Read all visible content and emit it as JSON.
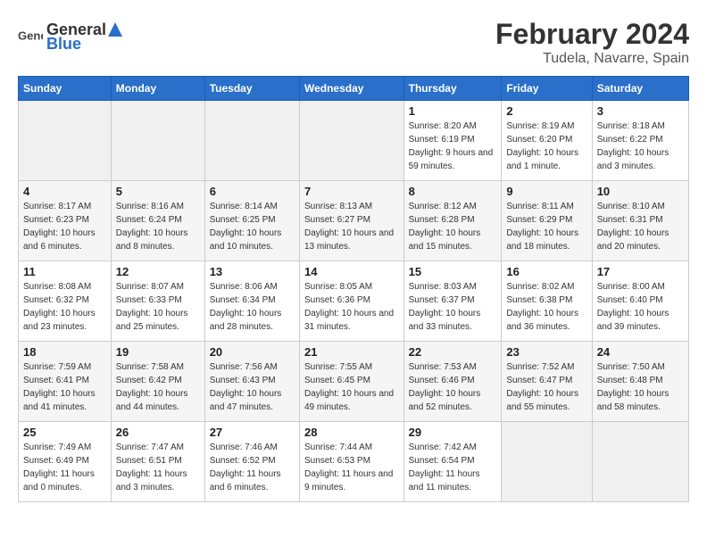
{
  "header": {
    "logo_general": "General",
    "logo_blue": "Blue",
    "title": "February 2024",
    "subtitle": "Tudela, Navarre, Spain"
  },
  "columns": [
    "Sunday",
    "Monday",
    "Tuesday",
    "Wednesday",
    "Thursday",
    "Friday",
    "Saturday"
  ],
  "weeks": [
    [
      {
        "day": "",
        "empty": true
      },
      {
        "day": "",
        "empty": true
      },
      {
        "day": "",
        "empty": true
      },
      {
        "day": "",
        "empty": true
      },
      {
        "day": "1",
        "sunrise": "Sunrise: 8:20 AM",
        "sunset": "Sunset: 6:19 PM",
        "daylight": "Daylight: 9 hours and 59 minutes."
      },
      {
        "day": "2",
        "sunrise": "Sunrise: 8:19 AM",
        "sunset": "Sunset: 6:20 PM",
        "daylight": "Daylight: 10 hours and 1 minute."
      },
      {
        "day": "3",
        "sunrise": "Sunrise: 8:18 AM",
        "sunset": "Sunset: 6:22 PM",
        "daylight": "Daylight: 10 hours and 3 minutes."
      }
    ],
    [
      {
        "day": "4",
        "sunrise": "Sunrise: 8:17 AM",
        "sunset": "Sunset: 6:23 PM",
        "daylight": "Daylight: 10 hours and 6 minutes."
      },
      {
        "day": "5",
        "sunrise": "Sunrise: 8:16 AM",
        "sunset": "Sunset: 6:24 PM",
        "daylight": "Daylight: 10 hours and 8 minutes."
      },
      {
        "day": "6",
        "sunrise": "Sunrise: 8:14 AM",
        "sunset": "Sunset: 6:25 PM",
        "daylight": "Daylight: 10 hours and 10 minutes."
      },
      {
        "day": "7",
        "sunrise": "Sunrise: 8:13 AM",
        "sunset": "Sunset: 6:27 PM",
        "daylight": "Daylight: 10 hours and 13 minutes."
      },
      {
        "day": "8",
        "sunrise": "Sunrise: 8:12 AM",
        "sunset": "Sunset: 6:28 PM",
        "daylight": "Daylight: 10 hours and 15 minutes."
      },
      {
        "day": "9",
        "sunrise": "Sunrise: 8:11 AM",
        "sunset": "Sunset: 6:29 PM",
        "daylight": "Daylight: 10 hours and 18 minutes."
      },
      {
        "day": "10",
        "sunrise": "Sunrise: 8:10 AM",
        "sunset": "Sunset: 6:31 PM",
        "daylight": "Daylight: 10 hours and 20 minutes."
      }
    ],
    [
      {
        "day": "11",
        "sunrise": "Sunrise: 8:08 AM",
        "sunset": "Sunset: 6:32 PM",
        "daylight": "Daylight: 10 hours and 23 minutes."
      },
      {
        "day": "12",
        "sunrise": "Sunrise: 8:07 AM",
        "sunset": "Sunset: 6:33 PM",
        "daylight": "Daylight: 10 hours and 25 minutes."
      },
      {
        "day": "13",
        "sunrise": "Sunrise: 8:06 AM",
        "sunset": "Sunset: 6:34 PM",
        "daylight": "Daylight: 10 hours and 28 minutes."
      },
      {
        "day": "14",
        "sunrise": "Sunrise: 8:05 AM",
        "sunset": "Sunset: 6:36 PM",
        "daylight": "Daylight: 10 hours and 31 minutes."
      },
      {
        "day": "15",
        "sunrise": "Sunrise: 8:03 AM",
        "sunset": "Sunset: 6:37 PM",
        "daylight": "Daylight: 10 hours and 33 minutes."
      },
      {
        "day": "16",
        "sunrise": "Sunrise: 8:02 AM",
        "sunset": "Sunset: 6:38 PM",
        "daylight": "Daylight: 10 hours and 36 minutes."
      },
      {
        "day": "17",
        "sunrise": "Sunrise: 8:00 AM",
        "sunset": "Sunset: 6:40 PM",
        "daylight": "Daylight: 10 hours and 39 minutes."
      }
    ],
    [
      {
        "day": "18",
        "sunrise": "Sunrise: 7:59 AM",
        "sunset": "Sunset: 6:41 PM",
        "daylight": "Daylight: 10 hours and 41 minutes."
      },
      {
        "day": "19",
        "sunrise": "Sunrise: 7:58 AM",
        "sunset": "Sunset: 6:42 PM",
        "daylight": "Daylight: 10 hours and 44 minutes."
      },
      {
        "day": "20",
        "sunrise": "Sunrise: 7:56 AM",
        "sunset": "Sunset: 6:43 PM",
        "daylight": "Daylight: 10 hours and 47 minutes."
      },
      {
        "day": "21",
        "sunrise": "Sunrise: 7:55 AM",
        "sunset": "Sunset: 6:45 PM",
        "daylight": "Daylight: 10 hours and 49 minutes."
      },
      {
        "day": "22",
        "sunrise": "Sunrise: 7:53 AM",
        "sunset": "Sunset: 6:46 PM",
        "daylight": "Daylight: 10 hours and 52 minutes."
      },
      {
        "day": "23",
        "sunrise": "Sunrise: 7:52 AM",
        "sunset": "Sunset: 6:47 PM",
        "daylight": "Daylight: 10 hours and 55 minutes."
      },
      {
        "day": "24",
        "sunrise": "Sunrise: 7:50 AM",
        "sunset": "Sunset: 6:48 PM",
        "daylight": "Daylight: 10 hours and 58 minutes."
      }
    ],
    [
      {
        "day": "25",
        "sunrise": "Sunrise: 7:49 AM",
        "sunset": "Sunset: 6:49 PM",
        "daylight": "Daylight: 11 hours and 0 minutes."
      },
      {
        "day": "26",
        "sunrise": "Sunrise: 7:47 AM",
        "sunset": "Sunset: 6:51 PM",
        "daylight": "Daylight: 11 hours and 3 minutes."
      },
      {
        "day": "27",
        "sunrise": "Sunrise: 7:46 AM",
        "sunset": "Sunset: 6:52 PM",
        "daylight": "Daylight: 11 hours and 6 minutes."
      },
      {
        "day": "28",
        "sunrise": "Sunrise: 7:44 AM",
        "sunset": "Sunset: 6:53 PM",
        "daylight": "Daylight: 11 hours and 9 minutes."
      },
      {
        "day": "29",
        "sunrise": "Sunrise: 7:42 AM",
        "sunset": "Sunset: 6:54 PM",
        "daylight": "Daylight: 11 hours and 11 minutes."
      },
      {
        "day": "",
        "empty": true
      },
      {
        "day": "",
        "empty": true
      }
    ]
  ]
}
